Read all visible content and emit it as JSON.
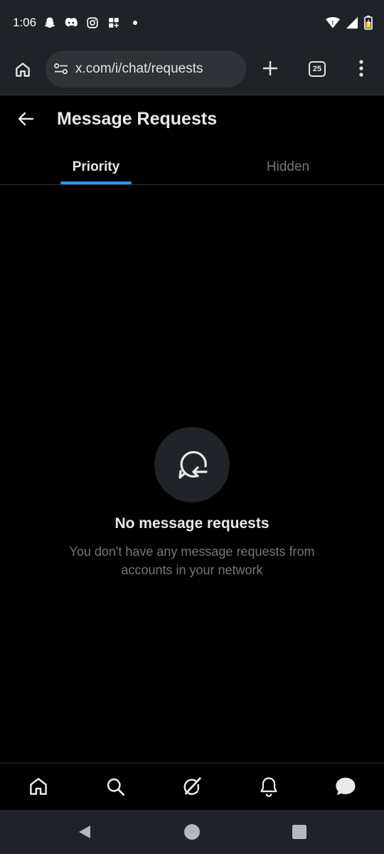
{
  "status_bar": {
    "time": "1:06",
    "notification_icons": [
      "snapchat-icon",
      "discord-icon",
      "instagram-icon",
      "grid-app-icon",
      "dot-icon"
    ],
    "system_icons": [
      "wifi-icon",
      "signal-icon",
      "battery-icon"
    ]
  },
  "browser": {
    "url": "x.com/i/chat/requests",
    "tab_count": "25"
  },
  "header": {
    "title": "Message Requests"
  },
  "tabs": [
    {
      "label": "Priority",
      "active": true
    },
    {
      "label": "Hidden",
      "active": false
    }
  ],
  "empty_state": {
    "title": "No message requests",
    "description": "You don't have any message requests from accounts in your network"
  },
  "bottom_nav": {
    "items": [
      "home-icon",
      "search-icon",
      "grok-icon",
      "notifications-icon",
      "messages-icon"
    ]
  },
  "colors": {
    "accent": "#1d9bf0",
    "background": "#000000",
    "chrome_bar": "#1f2227",
    "secondary_text": "#71767b"
  }
}
